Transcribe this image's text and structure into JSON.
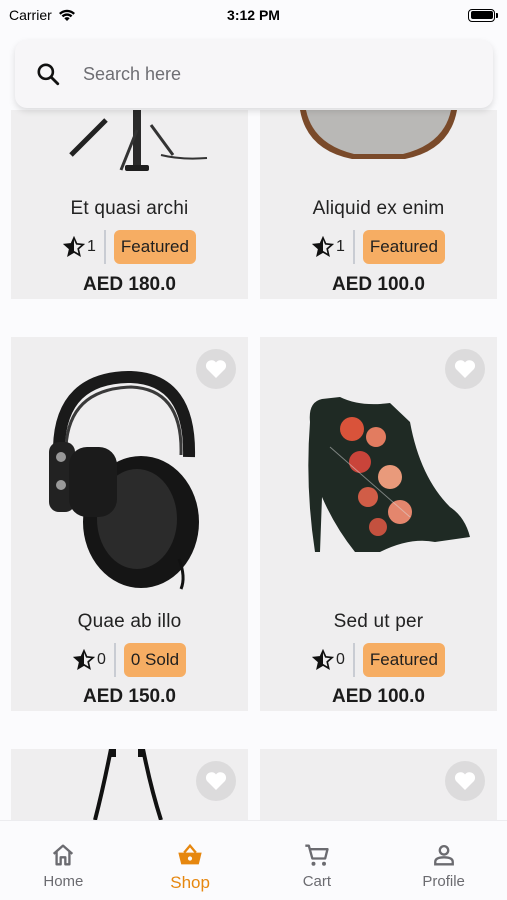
{
  "status": {
    "carrier": "Carrier",
    "time": "3:12 PM"
  },
  "search": {
    "placeholder": "Search here"
  },
  "colors": {
    "accent": "#e6870f",
    "badge": "#f6ad63",
    "card": "#efeeef"
  },
  "products": [
    {
      "title": "Et quasi archi",
      "rating": "1",
      "badge": "Featured",
      "price": "AED 180.0",
      "image": "microphone-stand"
    },
    {
      "title": "Aliquid ex enim",
      "rating": "1",
      "badge": "Featured",
      "price": "AED 100.0",
      "image": "speaker"
    },
    {
      "title": "Quae ab illo",
      "rating": "0",
      "badge": "0 Sold",
      "price": "AED 150.0",
      "image": "headphones"
    },
    {
      "title": "Sed ut per",
      "rating": "0",
      "badge": "Featured",
      "price": "AED 100.0",
      "image": "high-heel-shoe"
    },
    {
      "image": "bag-strap"
    },
    {
      "image": "blank"
    }
  ],
  "nav": {
    "items": [
      {
        "label": "Home",
        "icon": "home-icon"
      },
      {
        "label": "Shop",
        "icon": "shopping-basket-icon",
        "active": true
      },
      {
        "label": "Cart",
        "icon": "cart-icon"
      },
      {
        "label": "Profile",
        "icon": "profile-icon"
      }
    ]
  }
}
